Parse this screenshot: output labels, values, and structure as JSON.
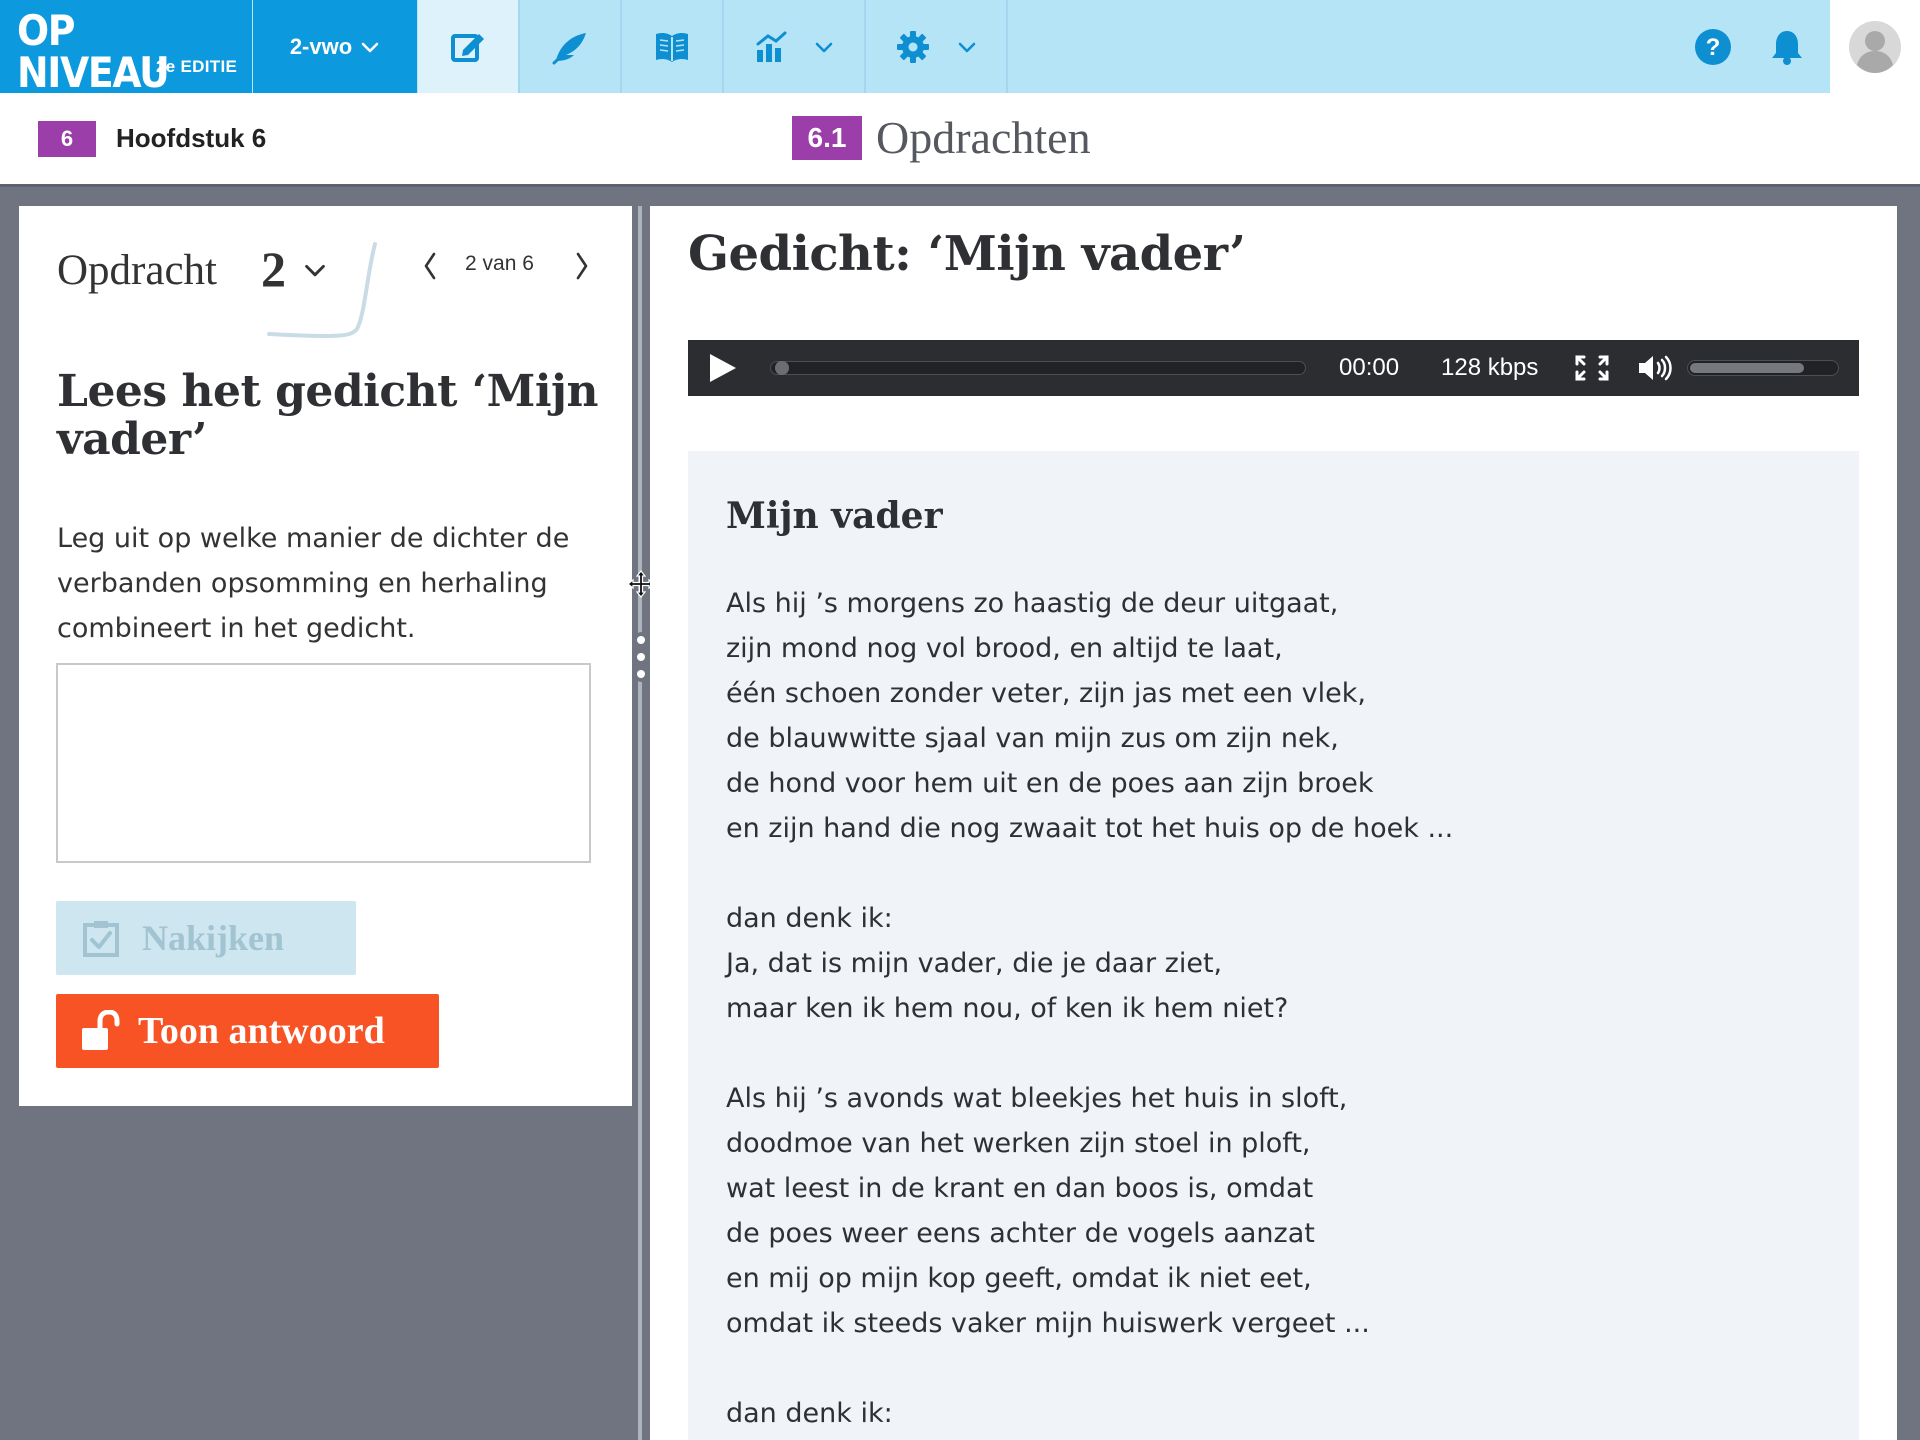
{
  "brand": {
    "name": "OP NIVEAU",
    "edition": "2e EDITIE"
  },
  "level": {
    "selected": "2-vwo"
  },
  "topnav": {
    "items": [
      {
        "icon": "edit-icon",
        "active": true
      },
      {
        "icon": "feather-icon",
        "active": false
      },
      {
        "icon": "book-icon",
        "active": false
      },
      {
        "icon": "chart-icon",
        "active": false,
        "dropdown": true
      },
      {
        "icon": "gear-icon",
        "active": false,
        "dropdown": true
      }
    ],
    "right": [
      "help-icon",
      "bell-icon",
      "user-avatar-icon"
    ]
  },
  "subheader": {
    "chapter_number": "6",
    "chapter_title": "Hoofdstuk 6",
    "section_number": "6.1",
    "section_title": "Opdrachten"
  },
  "exercise": {
    "label": "Opdracht",
    "number": "2",
    "pager": "2 van 6",
    "title": "Lees het gedicht ‘Mijn vader’",
    "question": "Leg uit op welke manier de dichter de verbanden opsomming en herhaling combineert in het gedicht.",
    "answer_value": "",
    "check_label": "Nakijken",
    "show_answer_label": "Toon antwoord"
  },
  "content": {
    "title": "Gedicht: ‘Mijn vader’",
    "player": {
      "time": "00:00",
      "bitrate": "128 kbps",
      "volume": 0.78
    },
    "poem_title": "Mijn vader",
    "stanzas": [
      [
        "Als hij ’s morgens zo haastig de deur uitgaat,",
        "zijn mond nog vol brood, en altijd te laat,",
        "één schoen zonder veter, zijn jas met een vlek,",
        "de blauwwitte sjaal van mijn zus om zijn nek,",
        "de hond voor hem uit en de poes aan zijn broek",
        "en zijn hand die nog zwaait tot het huis op de hoek ..."
      ],
      [
        "dan denk ik:",
        "Ja, dat is mijn vader, die je daar ziet,",
        "maar ken ik hem nou, of ken ik hem niet?"
      ],
      [
        "Als hij ’s avonds wat bleekjes het huis in sloft,",
        "doodmoe van het werken zijn stoel in ploft,",
        "wat leest in de krant en dan boos is, omdat",
        "de poes weer eens achter de vogels aanzat",
        "en mij op mijn kop geeft, omdat ik niet eet,",
        "omdat ik steeds vaker mijn huiswerk vergeet ..."
      ],
      [
        "dan denk ik:"
      ]
    ]
  },
  "colors": {
    "brand_blue": "#0d99dd",
    "nav_light": "#b6e4f7",
    "chapter_purple": "#9b3ea9",
    "answer_orange": "#f85325",
    "check_disabled": "#cde6ef",
    "background": "#6f7480"
  }
}
